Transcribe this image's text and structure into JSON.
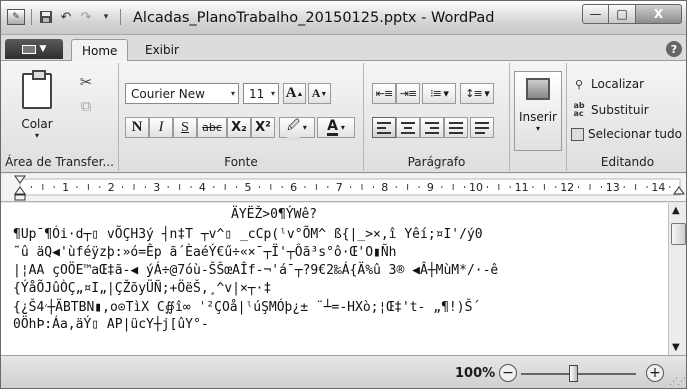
{
  "window": {
    "title": "Alcadas_PlanoTrabalho_20150125.pptx - WordPad",
    "minimize": "—",
    "maximize": "□",
    "close": "X"
  },
  "qat": {
    "app_icon": "wordpad-icon",
    "save_icon": "save-icon",
    "undo_icon": "undo-icon",
    "redo_icon": "redo-icon",
    "dropdown_icon": "chevron-down-icon"
  },
  "tabs": {
    "home": "Home",
    "view": "Exibir",
    "help": "?"
  },
  "clipboard": {
    "paste": "Colar",
    "group_label": "Área de Transfer..."
  },
  "font": {
    "family": "Courier New",
    "size": "11",
    "grow": "A",
    "shrink": "A",
    "bold": "N",
    "italic": "I",
    "underline": "S",
    "strike": "abc",
    "subscript": "X₂",
    "superscript": "X²",
    "highlight": "🖉",
    "color": "A",
    "group_label": "Fonte"
  },
  "paragraph": {
    "group_label": "Parágrafo"
  },
  "insert": {
    "label": "Inserir"
  },
  "editing": {
    "find": "Localizar",
    "replace": "Substituir",
    "select_all": "Selecionar tudo",
    "group_label": "Editando"
  },
  "ruler": {
    "labels": [
      "1",
      "2",
      "3",
      "4",
      "5",
      "6",
      "7",
      "8",
      "9",
      "10",
      "11",
      "12",
      "13",
      "14"
    ]
  },
  "document": {
    "lines": [
      "ÄYËŽ>0¶ÝWê?",
      "¶Up¯¶Ói·d┬▯ vÕÇH3ý ┤n‡T ┬v^▯ _cCp(ˡv°ÕM^ ß{|_>×,î Yêí;¤I'/ý0",
      "˜û äQ◀'ùféÿzþ:»ó=Êp ã´ÈaéÝ€ű÷«×¯┬Ï'┬Ôã³s°ô·Œ'O▮Ñh",
      "|¦AA çOÖE™aŒ‡ã-◀ ýÁ÷@7óù-ŠŠœAÎf-¬'á¯┬?9€2‰Á{Ä%û 3® ◀Â┼MùM*/·-ê",
      "{ÝåÕJûÒÇ„¤I„|ÇŽõyÜÑ;+ÖëŠ,¸^v|×┬·‡",
      "{¿Š׳4┼ÄBTBN▮,o⊙TìX C∯î∞ ˈ²ÇOå|ˡúŞMÓþ¿± ¨┴=-HXò;¦Œ‡'t- „¶!)Š´",
      "0ÖhÞ:Áa,äÝ▯ AP|ücY┼j[ûY°-"
    ]
  },
  "status": {
    "zoom": "100%",
    "zoom_out": "−",
    "zoom_in": "+",
    "zoom_level": 1.0
  }
}
